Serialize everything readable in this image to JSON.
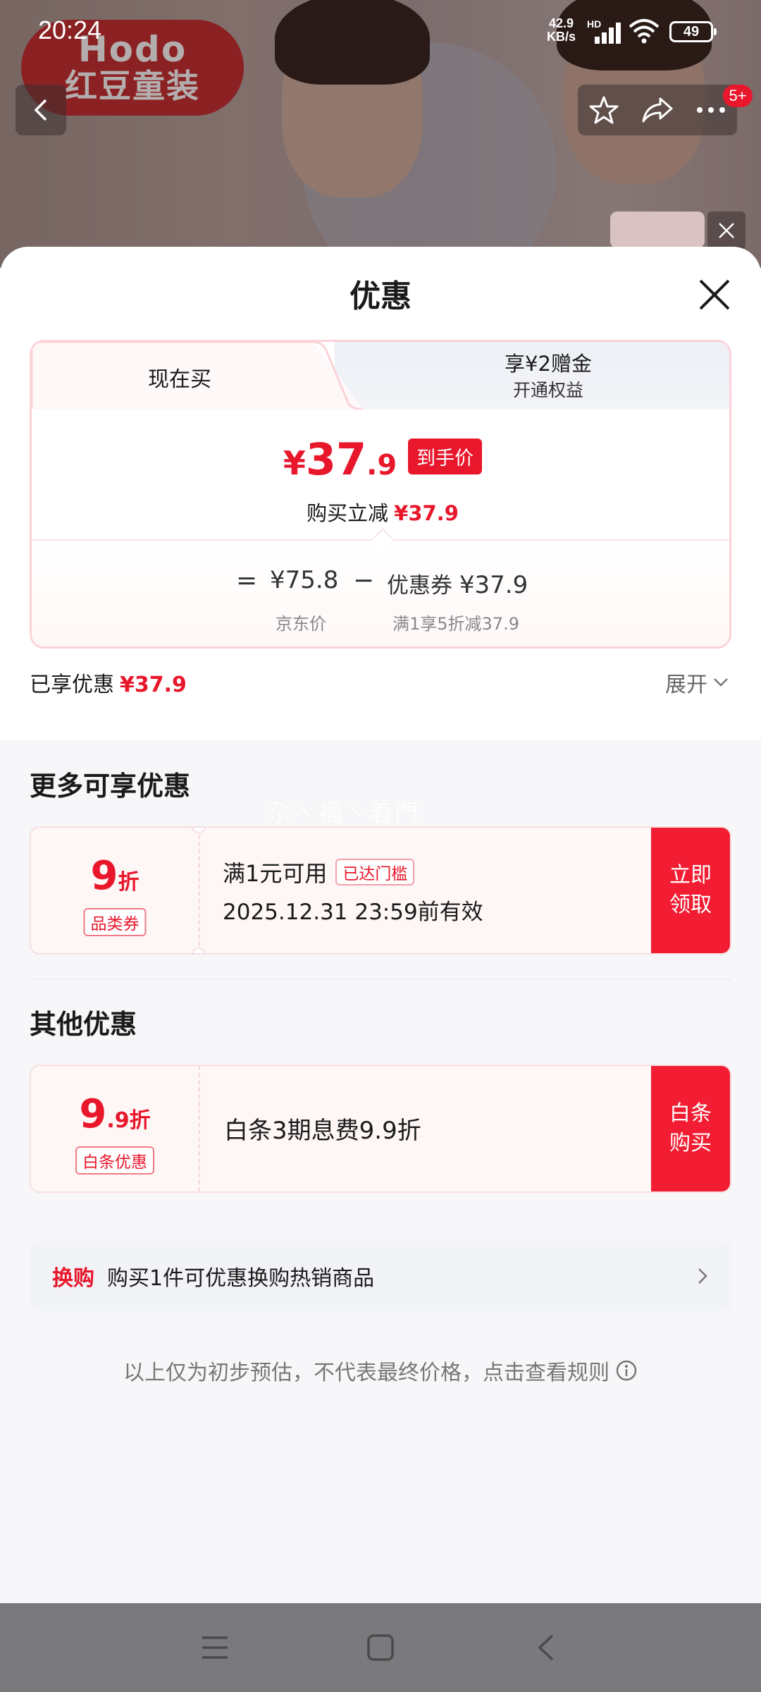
{
  "status_bar": {
    "time": "20:24",
    "net_speed_value": "42.9",
    "net_speed_unit": "KB/s",
    "net_type": "HD",
    "battery": "49"
  },
  "background": {
    "brand_logo_top": "Hodo",
    "brand_logo_cn": "红豆童装",
    "cart_badge": "5+"
  },
  "sheet": {
    "title": "优惠",
    "tabs": [
      {
        "label": "现在买"
      },
      {
        "label": "享¥2赠金",
        "sub": "开通权益"
      }
    ],
    "final_price": {
      "yen": "¥",
      "int": "37",
      "dec": ".9",
      "tag": "到手价"
    },
    "instant_discount": {
      "label": "购买立减",
      "amount": "¥37.9"
    },
    "formula": {
      "equals": "=",
      "jd_price": "¥75.8",
      "minus": "−",
      "coupon_label": "优惠券",
      "coupon_value": "¥37.9",
      "jd_price_caption": "京东价",
      "coupon_caption": "满1享5折减37.9"
    },
    "enjoyed": {
      "label": "已享优惠",
      "amount": "¥37.9"
    },
    "expand_label": "展开",
    "more_section_title": "更多可享优惠",
    "watermark": "尕丶福丶着門",
    "coupon": {
      "amount_big": "9",
      "amount_unit": "折",
      "type": "品类券",
      "condition": "满1元可用",
      "reached_tag": "已达门槛",
      "validity": "2025.12.31 23:59前有效",
      "button_line1": "立即",
      "button_line2": "领取"
    },
    "other_section_title": "其他优惠",
    "baitiao": {
      "amount_big": "9",
      "amount_small": ".9折",
      "type": "白条优惠",
      "text": "白条3期息费9.9折",
      "button_line1": "白条",
      "button_line2": "购买"
    },
    "swap": {
      "tag": "换购",
      "text": "购买1件可优惠换购热销商品"
    },
    "disclaimer": "以上仅为初步预估，不代表最终价格，点击查看规则"
  },
  "colors": {
    "accent_red": "#e8172b",
    "button_red": "#f21d32",
    "card_border": "#fbd3d8"
  },
  "icons": [
    "back-icon",
    "star-icon",
    "share-icon",
    "more-icon",
    "close-icon",
    "chevron-down-icon",
    "chevron-right-icon",
    "info-icon",
    "menu-icon",
    "home-icon",
    "nav-back-icon"
  ]
}
